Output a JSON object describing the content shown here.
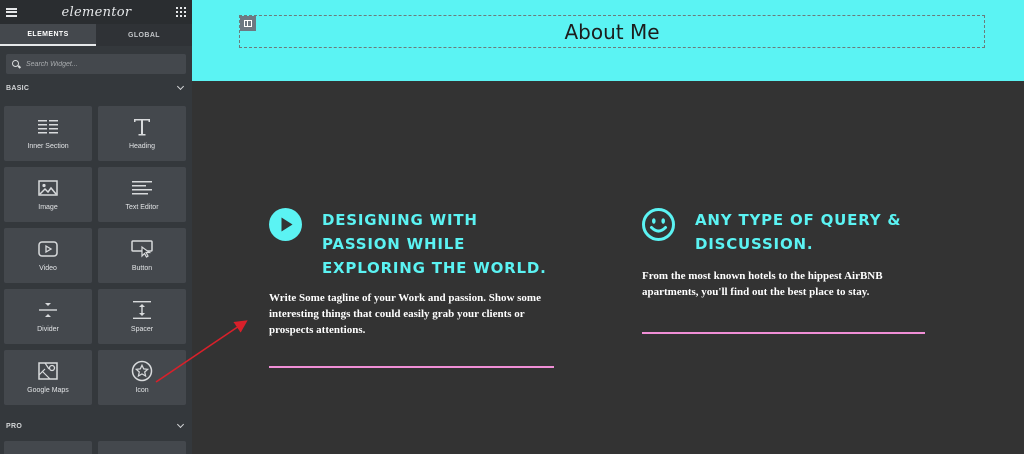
{
  "sidebar": {
    "logo": "elementor",
    "tabs": [
      {
        "label": "ELEMENTS",
        "active": true
      },
      {
        "label": "GLOBAL",
        "active": false
      }
    ],
    "search": {
      "placeholder": "Search Widget..."
    },
    "categories": {
      "basic": "BASIC",
      "pro": "PRO"
    },
    "widgets": [
      {
        "label": "Inner Section",
        "icon": "inner-section-icon"
      },
      {
        "label": "Heading",
        "icon": "heading-icon"
      },
      {
        "label": "Image",
        "icon": "image-icon"
      },
      {
        "label": "Text Editor",
        "icon": "text-editor-icon"
      },
      {
        "label": "Video",
        "icon": "video-icon"
      },
      {
        "label": "Button",
        "icon": "button-icon"
      },
      {
        "label": "Divider",
        "icon": "divider-icon"
      },
      {
        "label": "Spacer",
        "icon": "spacer-icon"
      },
      {
        "label": "Google Maps",
        "icon": "map-icon"
      },
      {
        "label": "Icon",
        "icon": "star-icon"
      }
    ]
  },
  "canvas": {
    "hero": {
      "title": "About Me",
      "background": "#5bf3f3"
    },
    "features": [
      {
        "icon": "play-circle-icon",
        "title": "DESIGNING WITH PASSION WHILE EXPLORING THE WORLD.",
        "text": "Write Some tagline of your Work and passion. Show some interesting things that could easily grab your clients or prospects attentions."
      },
      {
        "icon": "smile-icon",
        "title": "ANY TYPE OF QUERY & DISCUSSION.",
        "text": "From the most known hotels to the hippest AirBNB apartments, you'll find out the best place to stay."
      }
    ],
    "accent": "#5bf3f3",
    "divider_color": "#f08fd6"
  }
}
